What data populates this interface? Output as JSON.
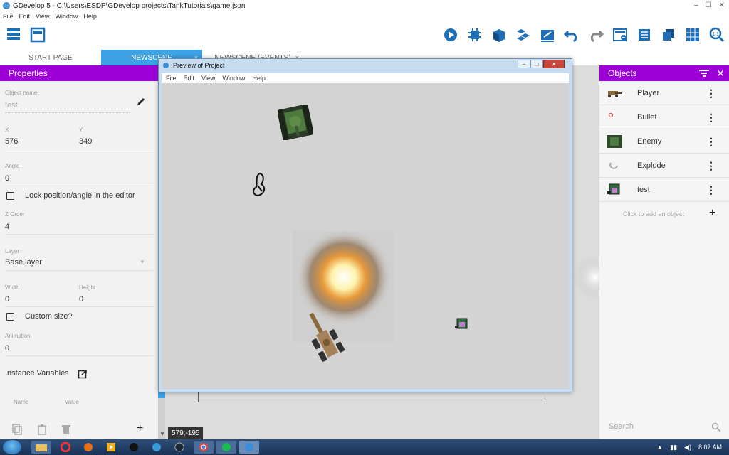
{
  "window": {
    "title": "GDevelop 5 - C:\\Users\\ESDP\\GDevelop projects\\TankTutorials\\game.json"
  },
  "menu": [
    "File",
    "Edit",
    "View",
    "Window",
    "Help"
  ],
  "tabs": [
    {
      "label": "START PAGE"
    },
    {
      "label": "NEWSCENE",
      "close": "×"
    },
    {
      "label": "NEWSCENE (EVENTS)",
      "close": "×"
    }
  ],
  "properties": {
    "title": "Properties",
    "object_name_label": "Object name",
    "object_name_value": "test",
    "x_label": "X",
    "x_value": "576",
    "y_label": "Y",
    "y_value": "349",
    "angle_label": "Angle",
    "angle_value": "0",
    "lock_label": "Lock position/angle in the editor",
    "zorder_label": "Z Order",
    "zorder_value": "4",
    "layer_label": "Layer",
    "layer_value": "Base layer",
    "width_label": "Width",
    "width_value": "0",
    "height_label": "Height",
    "height_value": "0",
    "custom_size_label": "Custom size?",
    "animation_label": "Animation",
    "animation_value": "0",
    "instance_vars_label": "Instance Variables",
    "col_name": "Name",
    "col_value": "Value"
  },
  "coords": "579;-195",
  "objects": {
    "title": "Objects",
    "items": [
      {
        "name": "Player",
        "icon": "player-tank-icon"
      },
      {
        "name": "Bullet",
        "icon": "bullet-icon"
      },
      {
        "name": "Enemy",
        "icon": "enemy-tank-icon"
      },
      {
        "name": "Explode",
        "icon": "explode-icon"
      },
      {
        "name": "test",
        "icon": "test-sprite-icon"
      }
    ],
    "add_hint": "Click to add an object",
    "search_placeholder": "Search"
  },
  "preview": {
    "title": "Preview of Project",
    "menu": [
      "File",
      "Edit",
      "View",
      "Window",
      "Help"
    ]
  },
  "taskbar": {
    "time": "8:07 AM"
  },
  "colors": {
    "panel_header": "#9d00d6",
    "tab_active": "#3ea3e6",
    "toolbar_icon": "#1e6fb8"
  }
}
